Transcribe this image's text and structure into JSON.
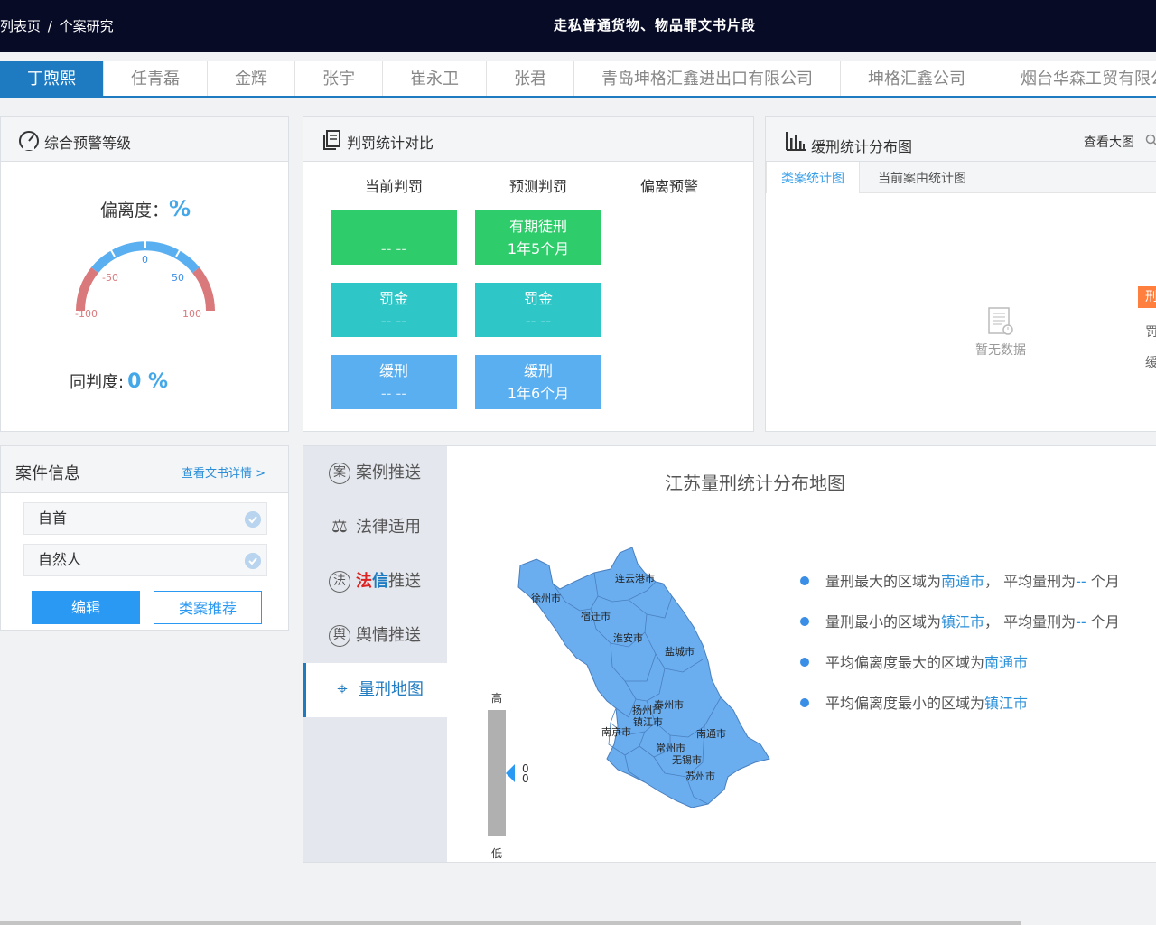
{
  "header": {
    "crumb_list": "列表页",
    "crumb_sep": "/",
    "crumb_current": "个案研究",
    "case_title": "走私普通货物、物品罪文书片段"
  },
  "tabs": [
    {
      "label": "丁煦熙",
      "active": true
    },
    {
      "label": "任青磊",
      "active": false
    },
    {
      "label": "金辉",
      "active": false
    },
    {
      "label": "张宇",
      "active": false
    },
    {
      "label": "崔永卫",
      "active": false
    },
    {
      "label": "张君",
      "active": false
    },
    {
      "label": "青岛坤格汇鑫进出口有限公司",
      "active": false
    },
    {
      "label": "坤格汇鑫公司",
      "active": false
    },
    {
      "label": "烟台华森工贸有限公",
      "active": false
    }
  ],
  "warning_panel": {
    "title": "综合预警等级",
    "deviation_label": "偏离度：",
    "deviation_unit": "%",
    "gauge_ticks": [
      "-100",
      "-50",
      "0",
      "50",
      "100"
    ],
    "same_label": "同判度:",
    "same_value": "0 %"
  },
  "compare_panel": {
    "title": "判罚统计对比",
    "col_current": "当前判罚",
    "col_predict": "预测判罚",
    "col_warning": "偏离预警",
    "current": [
      {
        "type": "",
        "value": "-- --"
      },
      {
        "type": "罚金",
        "value": "-- --"
      },
      {
        "type": "缓刑",
        "value": "-- --"
      }
    ],
    "predict": [
      {
        "type": "有期徒刑",
        "value": "1年5个月"
      },
      {
        "type": "罚金",
        "value": "-- --"
      },
      {
        "type": "缓刑",
        "value": "1年6个月"
      }
    ]
  },
  "distribution_panel": {
    "title": "缓刑统计分布图",
    "view_big": "查看大图",
    "tab_similar": "类案统计图",
    "tab_current": "当前案由统计图",
    "empty_text": "暂无数据",
    "side_badge": "刑",
    "side_item1": "罚",
    "side_item2": "缓"
  },
  "case_info": {
    "title": "案件信息",
    "view_doc": "查看文书详情 >",
    "field1": "自首",
    "field2": "自然人",
    "edit_label": "编辑",
    "recommend_label": "类案推荐"
  },
  "side_nav": [
    {
      "icon": "案",
      "label": "案例推送"
    },
    {
      "icon": "⚖",
      "label": "法律适用"
    },
    {
      "icon": "法",
      "label_red": "法",
      "label_blue": "信",
      "label_rest": "推送"
    },
    {
      "icon": "舆",
      "label": "舆情推送"
    },
    {
      "icon": "⌖",
      "label": "量刑地图"
    }
  ],
  "map": {
    "title": "江苏量刑统计分布地图",
    "legend_high": "高",
    "legend_low": "低",
    "legend_v1": "0",
    "legend_v2": "0",
    "cities": [
      "连云港市",
      "徐州市",
      "宿迁市",
      "淮安市",
      "盐城市",
      "扬州市",
      "泰州市",
      "镇江市",
      "南京市",
      "南通市",
      "常州市",
      "无锡市",
      "苏州市"
    ],
    "fill_color": "#6aaef0",
    "stats": [
      {
        "pre": "量刑最大的区域为",
        "city": "南通市",
        "mid": "，  平均量刑为",
        "val": "--",
        "post": " 个月"
      },
      {
        "pre": "量刑最小的区域为",
        "city": "镇江市",
        "mid": "，  平均量刑为",
        "val": "--",
        "post": " 个月"
      },
      {
        "pre": "平均偏离度最大的区域为",
        "city": "南通市"
      },
      {
        "pre": "平均偏离度最小的区域为",
        "city": "镇江市"
      }
    ]
  }
}
